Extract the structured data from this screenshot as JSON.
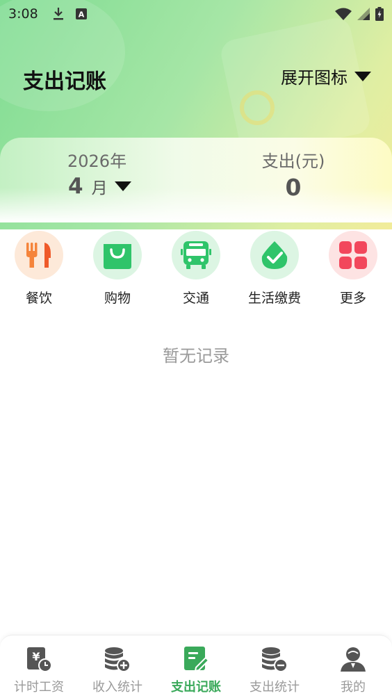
{
  "status_bar": {
    "time": "3:08",
    "icons": [
      "download-icon",
      "notification-a-icon",
      "wifi-icon",
      "signal-icon",
      "battery-icon"
    ]
  },
  "header": {
    "title": "支出记账",
    "expand_label": "展开图标"
  },
  "summary": {
    "year": "2026年",
    "month_num": "4",
    "month_unit": "月",
    "expense_label": "支出(元)",
    "expense_value": "0"
  },
  "categories": [
    {
      "label": "餐饮",
      "icon": "fork-knife-icon",
      "bg": "#fde9d9",
      "color": "#f5843b"
    },
    {
      "label": "购物",
      "icon": "shopping-bag-icon",
      "bg": "#dcf5e3",
      "color": "#2fc46a"
    },
    {
      "label": "交通",
      "icon": "bus-icon",
      "bg": "#dcf5e3",
      "color": "#2fc46a"
    },
    {
      "label": "生活缴费",
      "icon": "water-drop-check-icon",
      "bg": "#dcf5e3",
      "color": "#2fc46a"
    },
    {
      "label": "更多",
      "icon": "grid-more-icon",
      "bg": "#fde3e3",
      "color": "#f2475c"
    }
  ],
  "empty_text": "暂无记录",
  "tabs": [
    {
      "label": "计时工资",
      "icon": "timesheet-icon",
      "active": false
    },
    {
      "label": "收入统计",
      "icon": "coins-plus-icon",
      "active": false
    },
    {
      "label": "支出记账",
      "icon": "note-edit-icon",
      "active": true
    },
    {
      "label": "支出统计",
      "icon": "coins-minus-icon",
      "active": false
    },
    {
      "label": "我的",
      "icon": "user-icon",
      "active": false
    }
  ],
  "colors": {
    "accent": "#3aa95a",
    "inactive": "#9a9a9a",
    "tab_icon": "#555555"
  }
}
